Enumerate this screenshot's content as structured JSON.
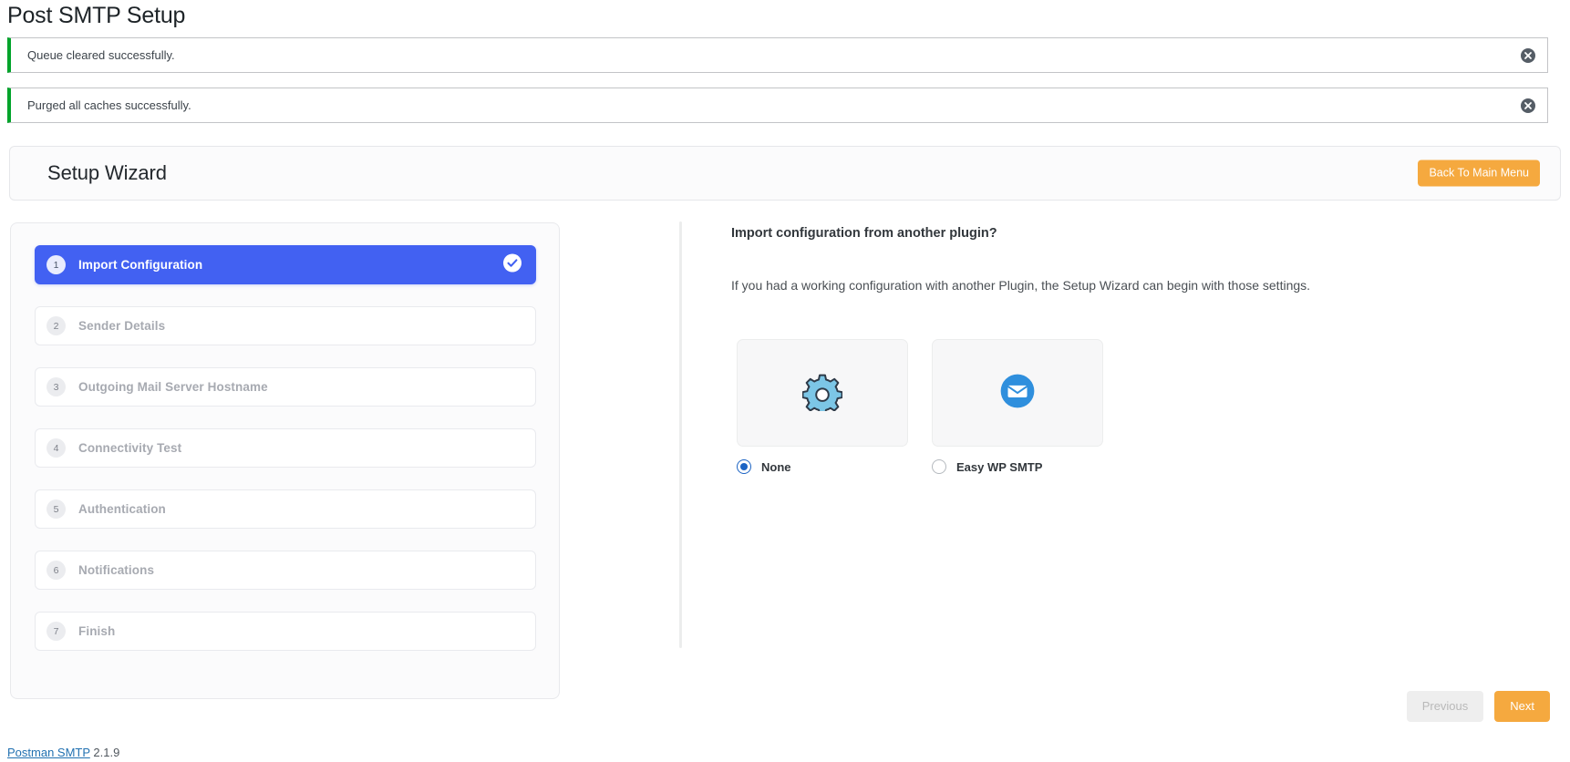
{
  "page": {
    "title": "Post SMTP Setup"
  },
  "notices": [
    {
      "message": "Queue cleared successfully.",
      "type": "success",
      "dismiss_icon": "close-circle-icon"
    },
    {
      "message": "Purged all caches successfully.",
      "type": "success",
      "dismiss_icon": "close-circle-icon"
    }
  ],
  "wizard": {
    "title": "Setup Wizard",
    "back_button": "Back To Main Menu",
    "accent_color": "#f5a93f",
    "active_step_color": "#4261f2",
    "steps": [
      {
        "number": "1",
        "label": "Import Configuration",
        "active": true,
        "completed": true
      },
      {
        "number": "2",
        "label": "Sender Details",
        "active": false,
        "completed": false
      },
      {
        "number": "3",
        "label": "Outgoing Mail Server Hostname",
        "active": false,
        "completed": false
      },
      {
        "number": "4",
        "label": "Connectivity Test",
        "active": false,
        "completed": false
      },
      {
        "number": "5",
        "label": "Authentication",
        "active": false,
        "completed": false
      },
      {
        "number": "6",
        "label": "Notifications",
        "active": false,
        "completed": false
      },
      {
        "number": "7",
        "label": "Finish",
        "active": false,
        "completed": false
      }
    ],
    "content": {
      "heading": "Import configuration from another plugin?",
      "description": "If you had a working configuration with another Plugin, the Setup Wizard can begin with those settings.",
      "options": [
        {
          "label": "None",
          "icon": "gear-icon",
          "selected": true,
          "icon_color": "#7cc6e6"
        },
        {
          "label": "Easy WP SMTP",
          "icon": "envelope-icon",
          "selected": false,
          "icon_color": "#2f8fdd"
        }
      ]
    },
    "actions": {
      "previous": "Previous",
      "previous_disabled": true,
      "next": "Next"
    }
  },
  "footer": {
    "link_text": "Postman SMTP",
    "version": "2.1.9"
  }
}
